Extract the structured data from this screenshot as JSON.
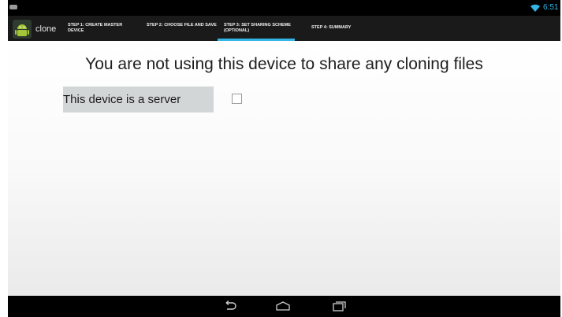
{
  "status_bar": {
    "time": "6:51",
    "notification_icon": "controller-icon",
    "wifi_icon": "wifi-icon"
  },
  "action_bar": {
    "app_title": "clone",
    "app_icon": "android-app-icon",
    "tabs": [
      {
        "label": "STEP 1: CREATE MASTER DEVICE",
        "selected": false
      },
      {
        "label": "STEP 2: CHOOSE FILE AND SAVE",
        "selected": false
      },
      {
        "label": "STEP 3: SET SHARING SCHEME (OPTIONAL)",
        "selected": true
      },
      {
        "label": "STEP 4: SUMMARY",
        "selected": false
      }
    ]
  },
  "main": {
    "headline": "You are not using this device to share any cloning files",
    "server_option": {
      "label": "This device is a server",
      "checked": false
    }
  },
  "nav_bar": {
    "buttons": [
      "back-icon",
      "home-icon",
      "recents-icon"
    ]
  },
  "colors": {
    "accent": "#33b5e5",
    "action_bar": "#1a1a1a",
    "label_bg": "#d2d6d6"
  }
}
